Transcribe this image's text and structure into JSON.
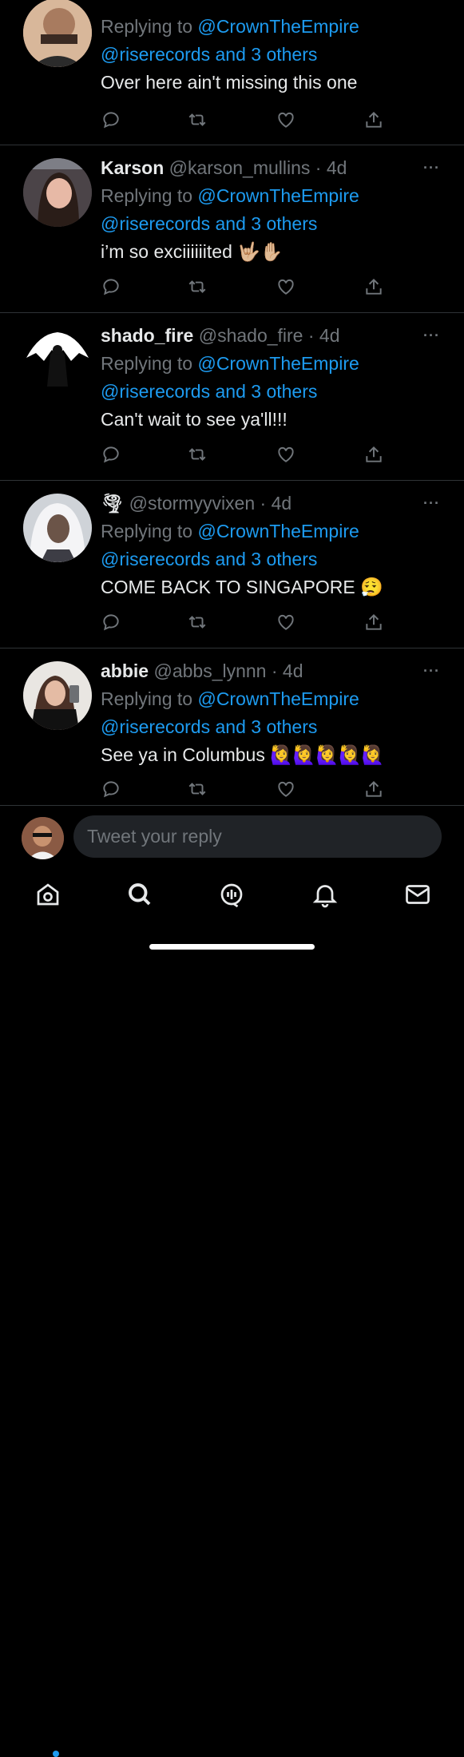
{
  "tweets": [
    {
      "name": "",
      "handle": "",
      "time": "",
      "reply_prefix": "Replying to",
      "reply_first": "@CrownTheEmpire",
      "reply_rest": "@riserecords and 3 others",
      "text": "Over here ain't missing this one"
    },
    {
      "name": "Karson",
      "handle": "@karson_mullins",
      "time": "· 4d",
      "reply_prefix": "Replying to",
      "reply_first": "@CrownTheEmpire",
      "reply_rest": "@riserecords and 3 others",
      "text": "i’m so exciiiiiited 🤟🏼✋🏼"
    },
    {
      "name": "shado_fire",
      "handle": "@shado_fire",
      "time": "· 4d",
      "reply_prefix": "Replying to",
      "reply_first": "@CrownTheEmpire",
      "reply_rest": "@riserecords and 3 others",
      "text": "Can't wait to see ya'll!!!"
    },
    {
      "name": "🌪",
      "handle": "@stormyyvixen",
      "time": "· 4d",
      "reply_prefix": "Replying to",
      "reply_first": "@CrownTheEmpire",
      "reply_rest": "@riserecords and 3 others",
      "text": "COME BACK TO SINGAPORE 😮‍💨"
    },
    {
      "name": "abbie",
      "handle": "@abbs_lynnn",
      "time": "· 4d",
      "reply_prefix": "Replying to",
      "reply_first": "@CrownTheEmpire",
      "reply_rest": "@riserecords and 3 others",
      "text": "See ya in Columbus 🙋‍♀️🙋‍♀️🙋‍♀️🙋‍♀️🙋‍♀️"
    }
  ],
  "more_label": "···",
  "composer": {
    "placeholder": "Tweet your reply"
  },
  "tabs": [
    "home-icon",
    "search-icon",
    "spaces-icon",
    "notifications-icon",
    "messages-icon"
  ],
  "colors": {
    "accent": "#1d9bf0",
    "muted": "#71767b",
    "background": "#000000"
  }
}
